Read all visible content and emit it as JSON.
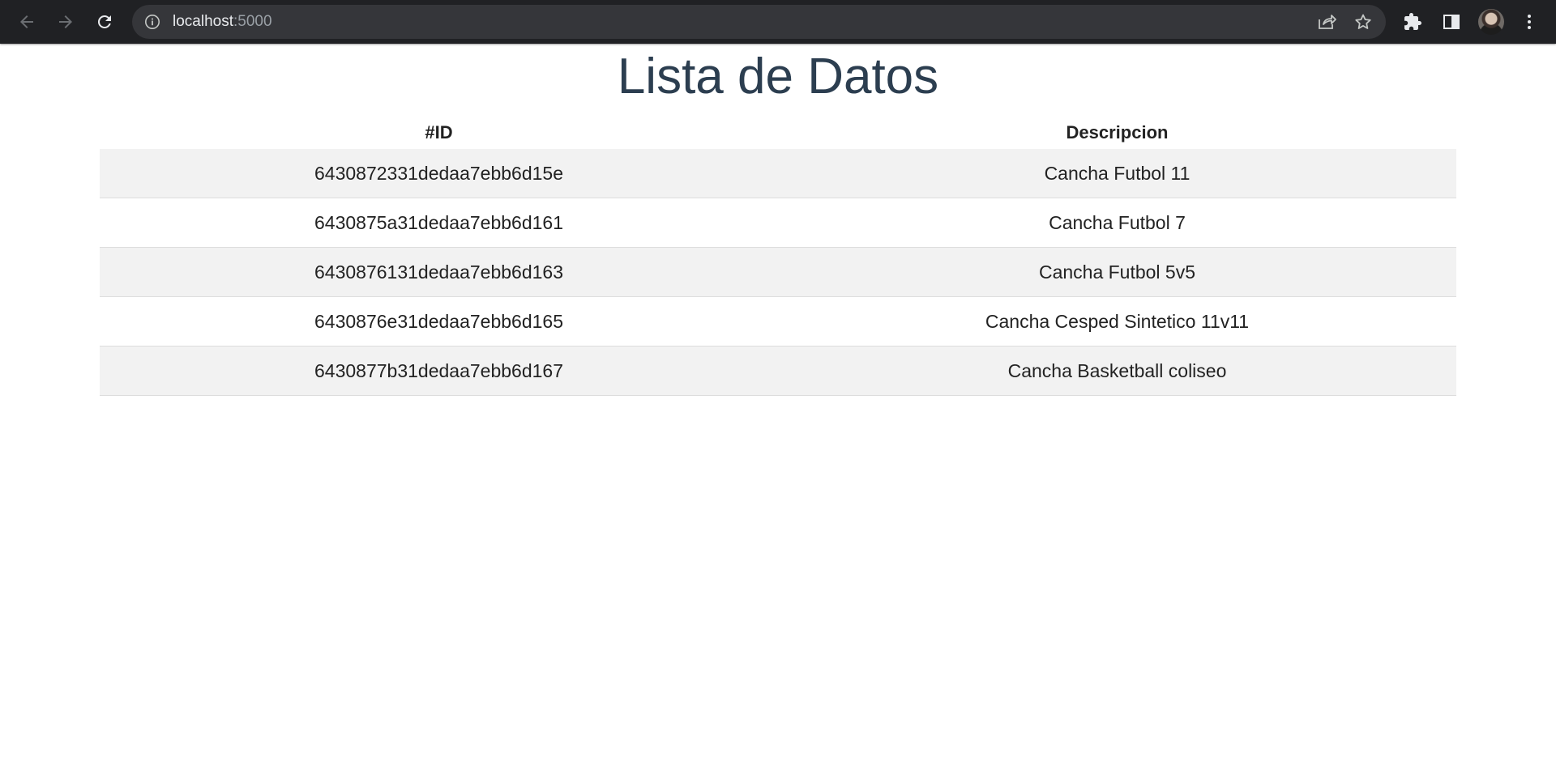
{
  "browser": {
    "url_host": "localhost",
    "url_port": ":5000",
    "icons": [
      "back-arrow-icon",
      "forward-arrow-icon",
      "reload-icon",
      "info-icon",
      "share-icon",
      "star-icon",
      "extensions-icon",
      "side-panel-icon",
      "profile-avatar",
      "kebab-menu-icon"
    ]
  },
  "page": {
    "title": "Lista de Datos"
  },
  "table": {
    "headers": [
      "#ID",
      "Descripcion"
    ],
    "rows": [
      [
        "6430872331dedaa7ebb6d15e",
        "Cancha Futbol 11"
      ],
      [
        "6430875a31dedaa7ebb6d161",
        "Cancha Futbol 7"
      ],
      [
        "6430876131dedaa7ebb6d163",
        "Cancha Futbol 5v5"
      ],
      [
        "6430876e31dedaa7ebb6d165",
        "Cancha Cesped Sintetico 11v11"
      ],
      [
        "6430877b31dedaa7ebb6d167",
        "Cancha Basketball coliseo"
      ]
    ]
  },
  "colors": {
    "toolbar_bg": "#202124",
    "omnibox_bg": "#35363a",
    "title_color": "#2c3e50",
    "row_stripe": "#f2f2f2"
  }
}
